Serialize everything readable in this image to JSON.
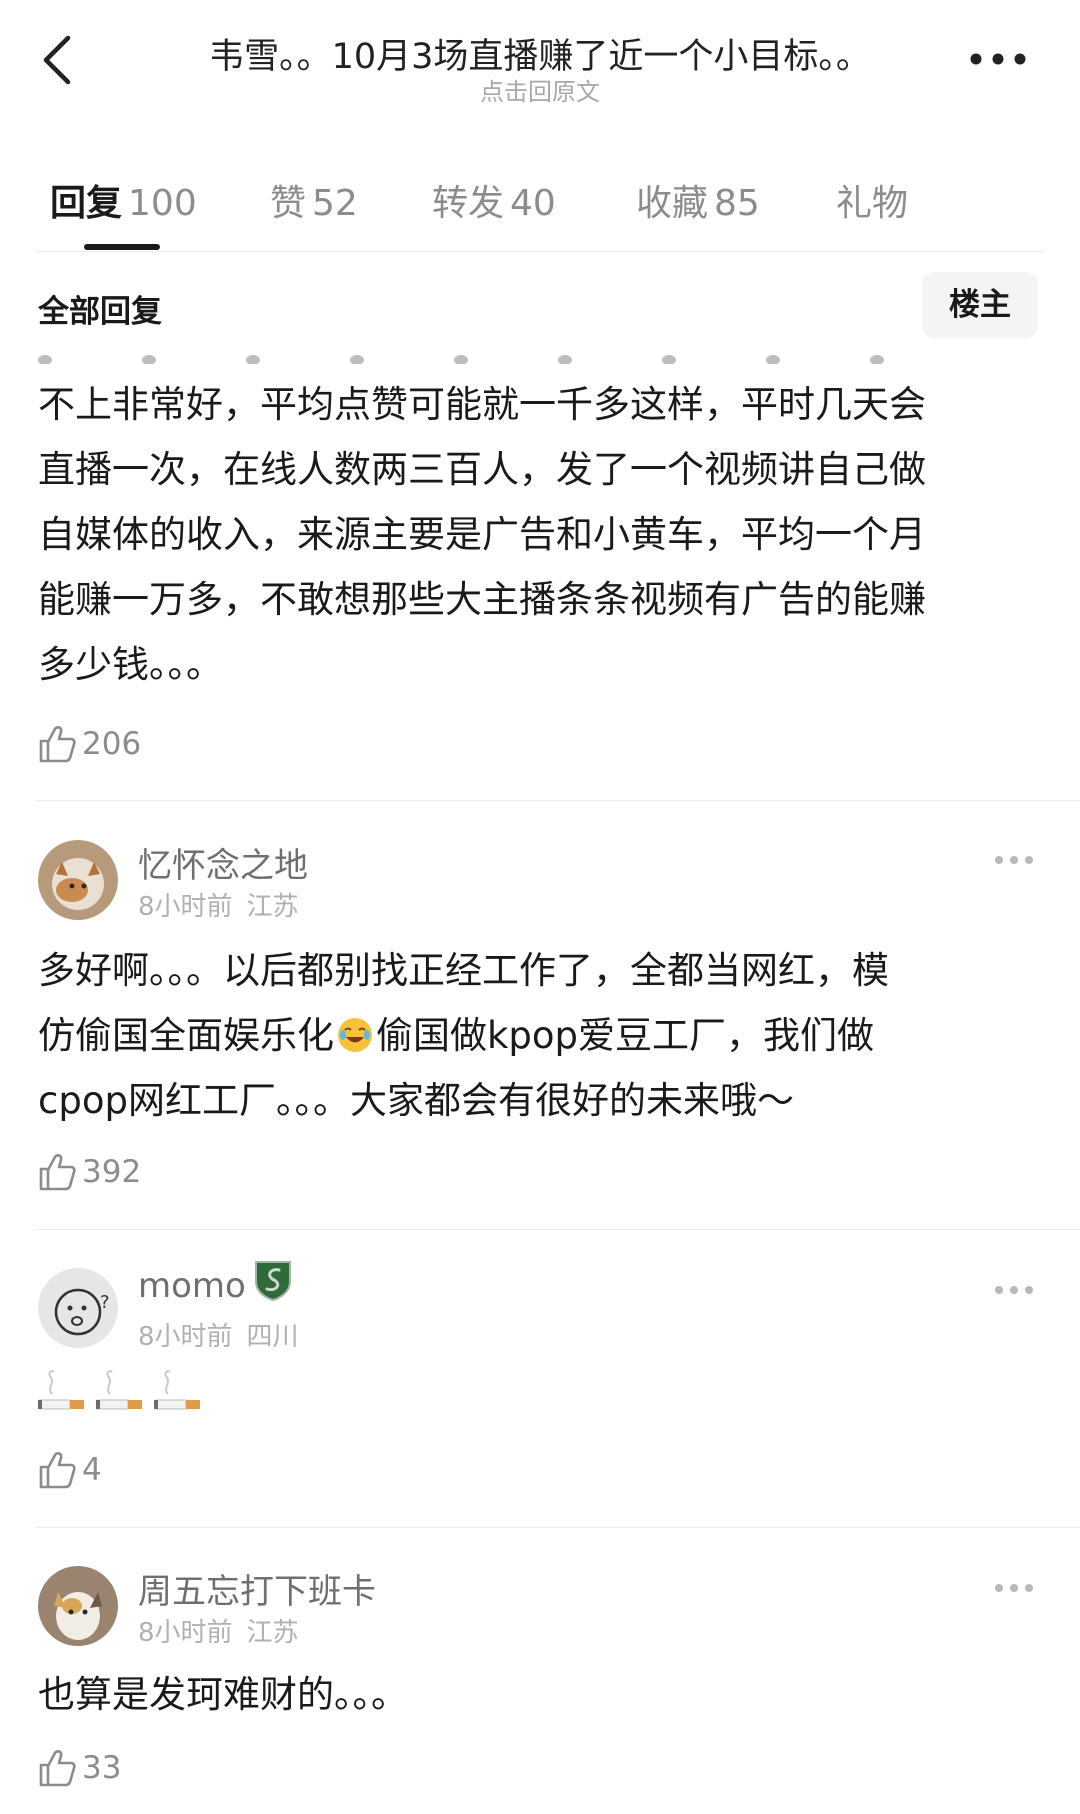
{
  "header": {
    "title": "韦雪。。10月3场直播赚了近一个小目标。。",
    "subtitle": "点击回原文"
  },
  "tabs": [
    {
      "label": "回复",
      "count": "100"
    },
    {
      "label": "赞",
      "count": "52"
    },
    {
      "label": "转发",
      "count": "40"
    },
    {
      "label": "收藏",
      "count": "85"
    },
    {
      "label": "礼物",
      "count": ""
    }
  ],
  "filter": {
    "section_title": "全部回复",
    "owner_button": "楼主"
  },
  "comments": [
    {
      "lines": [
        "不上非常好，平均点赞可能就一千多这样，平时几天会",
        "直播一次，在线人数两三百人，发了一个视频讲自己做",
        "自媒体的收入，来源主要是广告和小黄车，平均一个月",
        "能赚一万多，不敢想那些大主播条条视频有广告的能赚",
        "多少钱。。。"
      ],
      "likes": "206"
    },
    {
      "username": "忆怀念之地",
      "time": "8小时前",
      "location": "江苏",
      "line1": "多好啊。。。以后都别找正经工作了，全都当网红，模",
      "line2_before": "仿偷国全面娱乐化",
      "emoji": "tears-of-joy-emoji",
      "line2_after": "偷国做kpop爱豆工厂，我们做",
      "line3": "cpop网红工厂。。。大家都会有很好的未来哦～",
      "likes": "392"
    },
    {
      "username": "momo",
      "badge": "slytherin-badge-icon",
      "time": "8小时前",
      "location": "四川",
      "content_icons": [
        "cigarette-emoji",
        "cigarette-emoji",
        "cigarette-emoji"
      ],
      "likes": "4"
    },
    {
      "username": "周五忘打下班卡",
      "time": "8小时前",
      "location": "江苏",
      "text": "也算是发珂难财的。。。",
      "likes": "33"
    }
  ],
  "colors": {
    "primary_text": "#1a1a1a",
    "secondary_text": "#8c8c8c",
    "muted_text": "#b0b0b0",
    "divider": "#ececec",
    "owner_button_bg": "#f4f4f4"
  },
  "icons": [
    "back-arrow-icon",
    "more-icon",
    "thumbs-up-icon"
  ]
}
